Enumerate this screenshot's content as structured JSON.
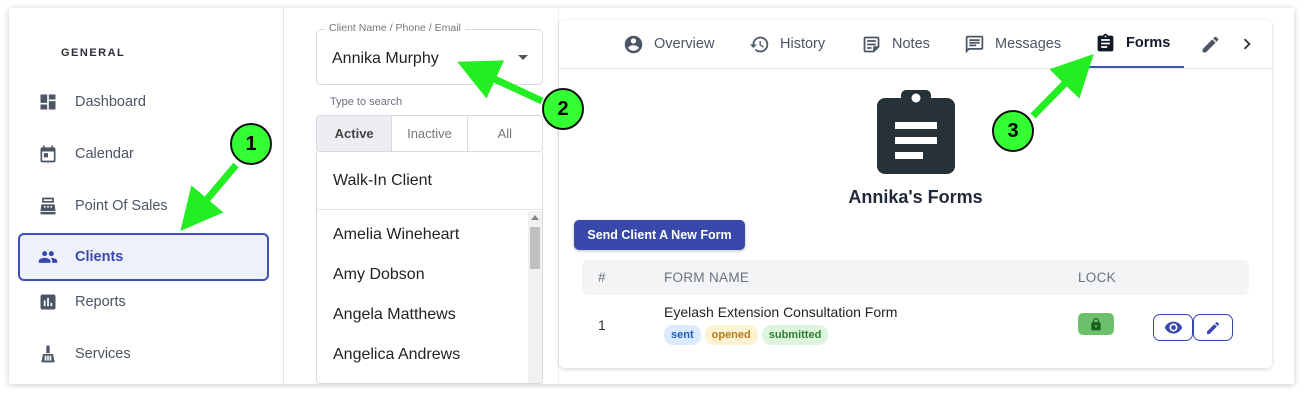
{
  "sidebar": {
    "heading": "GENERAL",
    "items": [
      {
        "label": "Dashboard",
        "icon": "dashboard-icon"
      },
      {
        "label": "Calendar",
        "icon": "calendar-icon"
      },
      {
        "label": "Point Of Sales",
        "icon": "register-icon"
      },
      {
        "label": "Clients",
        "icon": "people-icon",
        "active": true
      },
      {
        "label": "Reports",
        "icon": "chart-icon"
      },
      {
        "label": "Services",
        "icon": "broom-icon"
      }
    ]
  },
  "client_panel": {
    "select_label": "Client Name / Phone / Email",
    "selected_client": "Annika Murphy",
    "hint": "Type to search",
    "filters": [
      "Active",
      "Inactive",
      "All"
    ],
    "active_filter": "Active",
    "walk_in": "Walk-In Client",
    "clients": [
      "Amelia Wineheart",
      "Amy Dobson",
      "Angela Matthews",
      "Angelica Andrews"
    ]
  },
  "tabs": [
    {
      "label": "Overview",
      "icon": "account-circle-icon"
    },
    {
      "label": "History",
      "icon": "history-icon"
    },
    {
      "label": "Notes",
      "icon": "notes-icon"
    },
    {
      "label": "Messages",
      "icon": "message-icon"
    },
    {
      "label": "Forms",
      "icon": "clipboard-icon",
      "active": true
    }
  ],
  "forms": {
    "title": "Annika's Forms",
    "send_button": "Send Client A New Form",
    "columns": {
      "num": "#",
      "name": "FORM NAME",
      "lock": "LOCK"
    },
    "rows": [
      {
        "num": "1",
        "name": "Eyelash Extension Consultation Form",
        "statuses": [
          "sent",
          "opened",
          "submitted"
        ],
        "locked": true
      }
    ]
  },
  "annotations": [
    "1",
    "2",
    "3"
  ],
  "colors": {
    "accent": "#3949ab",
    "callout": "#33ff33",
    "arrow": "#22ee22",
    "badge_sent_bg": "#dbeafe",
    "badge_sent_fg": "#1e5fb4",
    "badge_opened_bg": "#fdf3d2",
    "badge_opened_fg": "#b7791f",
    "badge_submitted_bg": "#dcf5dc",
    "badge_submitted_fg": "#2f7d32"
  }
}
